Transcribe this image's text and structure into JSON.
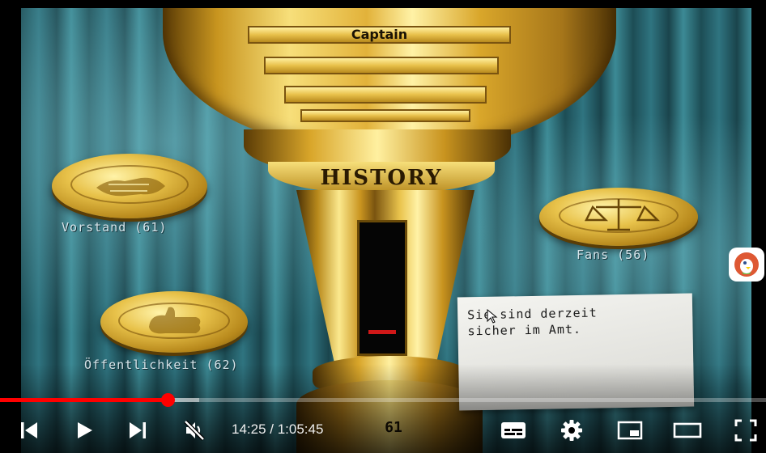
{
  "video": {
    "trophy_plaque_text": "Captain",
    "trophy_band_text": "HISTORY",
    "trophy_score": "61",
    "labels": {
      "board": "Vorstand (61)",
      "public": "Öffentlichkeit (62)",
      "fans": "Fans (56)"
    },
    "note_line1": "Sie sind derzeit",
    "note_line2": "sicher im Amt."
  },
  "player": {
    "time_display": "14:25 / 1:05:45",
    "progress_fraction": 0.219,
    "buffered_fraction": 0.26,
    "accent_color": "#ff0000",
    "icons": [
      "previous-icon",
      "play-icon",
      "next-icon",
      "mute-icon",
      "subtitles-icon",
      "settings-icon",
      "miniplayer-icon",
      "theater-icon",
      "fullscreen-icon"
    ]
  },
  "extension": {
    "icon": "duckduckgo-icon"
  }
}
